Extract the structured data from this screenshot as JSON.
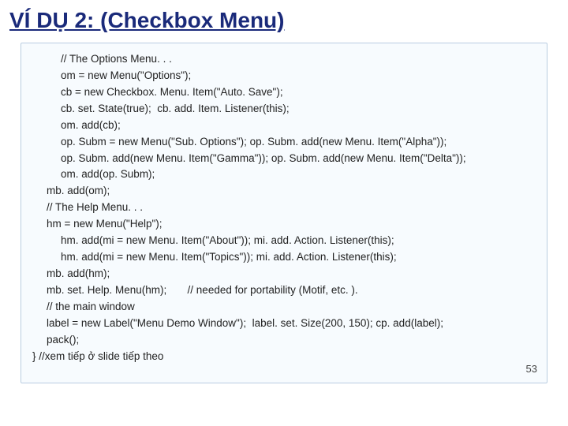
{
  "title": "VÍ DỤ 2: (Checkbox Menu)",
  "page_number": "53",
  "code": {
    "l1": "// The Options Menu. . .",
    "l2": "om = new Menu(\"Options\");",
    "l3": "cb = new Checkbox. Menu. Item(\"Auto. Save\");",
    "l4": "cb. set. State(true);  cb. add. Item. Listener(this);",
    "l5": "om. add(cb);",
    "l6": "op. Subm = new Menu(\"Sub. Options\"); op. Subm. add(new Menu. Item(\"Alpha\"));",
    "l7": "op. Subm. add(new Menu. Item(\"Gamma\")); op. Subm. add(new Menu. Item(\"Delta\"));",
    "l8": "om. add(op. Subm);",
    "l9": "mb. add(om);",
    "l10": "// The Help Menu. . .",
    "l11": "hm = new Menu(\"Help\");",
    "l12": "hm. add(mi = new Menu. Item(\"About\")); mi. add. Action. Listener(this);",
    "l13": "hm. add(mi = new Menu. Item(\"Topics\")); mi. add. Action. Listener(this);",
    "l14": "mb. add(hm);",
    "l15": "mb. set. Help. Menu(hm);       // needed for portability (Motif, etc. ).",
    "l16": "// the main window",
    "l17": "label = new Label(\"Menu Demo Window\");  label. set. Size(200, 150); cp. add(label);",
    "l18": "pack();",
    "l19": "} //xem tiếp ở slide tiếp theo"
  }
}
